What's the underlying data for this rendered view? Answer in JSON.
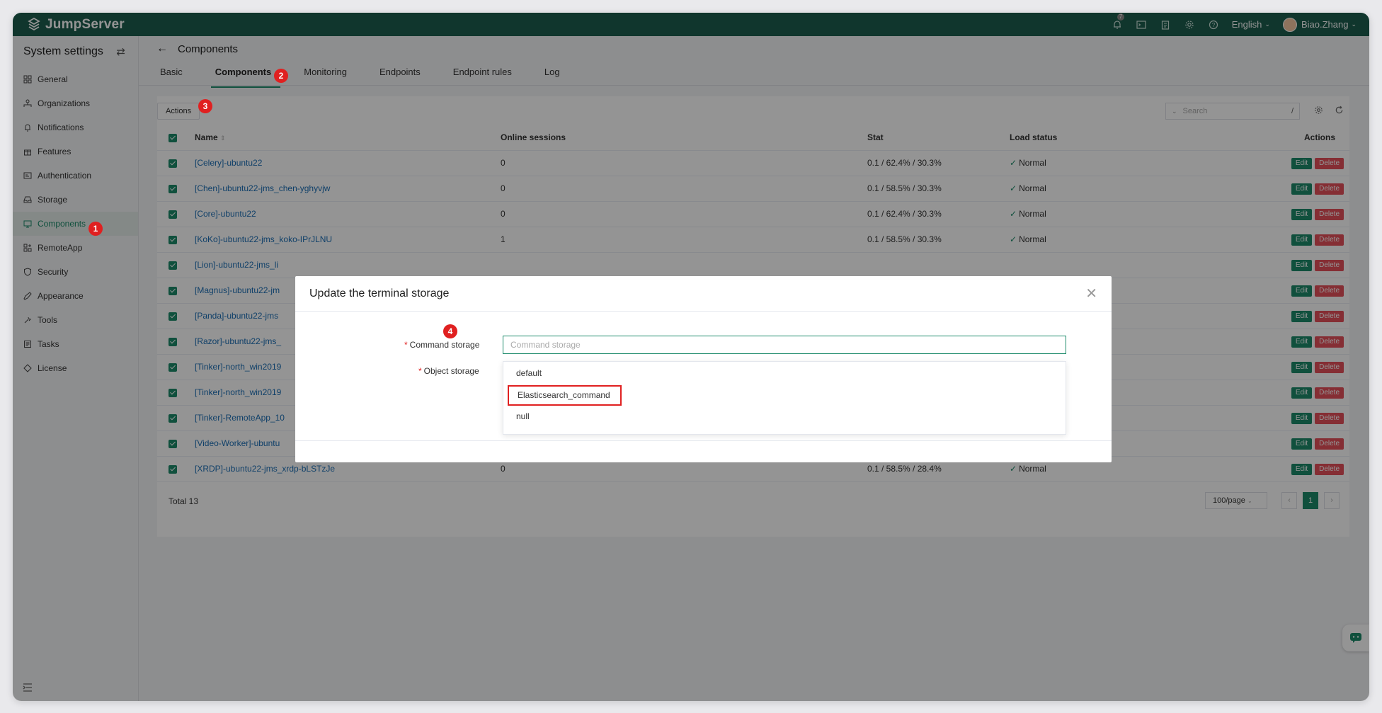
{
  "app": {
    "logo_text": "JumpServer",
    "notification_count": "7",
    "language": "English",
    "user_name": "Biao.Zhang"
  },
  "sidebar": {
    "title": "System settings",
    "items": [
      {
        "label": "General",
        "icon": "grid-icon"
      },
      {
        "label": "Organizations",
        "icon": "org-icon"
      },
      {
        "label": "Notifications",
        "icon": "bell-icon"
      },
      {
        "label": "Features",
        "icon": "gift-icon"
      },
      {
        "label": "Authentication",
        "icon": "id-card-icon"
      },
      {
        "label": "Storage",
        "icon": "inbox-icon"
      },
      {
        "label": "Components",
        "icon": "monitor-icon"
      },
      {
        "label": "RemoteApp",
        "icon": "apps-icon"
      },
      {
        "label": "Security",
        "icon": "shield-icon"
      },
      {
        "label": "Appearance",
        "icon": "brush-icon"
      },
      {
        "label": "Tools",
        "icon": "tools-icon"
      },
      {
        "label": "Tasks",
        "icon": "tasks-icon"
      },
      {
        "label": "License",
        "icon": "license-icon"
      }
    ],
    "active_item": "Components"
  },
  "page": {
    "title": "Components",
    "tabs": [
      "Basic",
      "Components",
      "Monitoring",
      "Endpoints",
      "Endpoint rules",
      "Log"
    ],
    "active_tab": "Components"
  },
  "toolbar": {
    "actions_label": "Actions",
    "search_placeholder": "Search",
    "search_shortcut": "/"
  },
  "table": {
    "columns": [
      "Name",
      "Online sessions",
      "Stat",
      "Load status",
      "Actions"
    ],
    "rows": [
      {
        "name": "[Celery]-ubuntu22",
        "sessions": "0",
        "stat": "0.1 / 62.4% / 30.3%",
        "status": "Normal"
      },
      {
        "name": "[Chen]-ubuntu22-jms_chen-yghyvjw",
        "sessions": "0",
        "stat": "0.1 / 58.5% / 30.3%",
        "status": "Normal"
      },
      {
        "name": "[Core]-ubuntu22",
        "sessions": "0",
        "stat": "0.1 / 62.4% / 30.3%",
        "status": "Normal"
      },
      {
        "name": "[KoKo]-ubuntu22-jms_koko-IPrJLNU",
        "sessions": "1",
        "stat": "0.1 / 58.5% / 30.3%",
        "status": "Normal"
      },
      {
        "name": "[Lion]-ubuntu22-jms_li",
        "sessions": "",
        "stat": "",
        "status": ""
      },
      {
        "name": "[Magnus]-ubuntu22-jm",
        "sessions": "",
        "stat": "",
        "status": ""
      },
      {
        "name": "[Panda]-ubuntu22-jms",
        "sessions": "",
        "stat": "",
        "status": ""
      },
      {
        "name": "[Razor]-ubuntu22-jms_",
        "sessions": "",
        "stat": "",
        "status": ""
      },
      {
        "name": "[Tinker]-north_win2019",
        "sessions": "",
        "stat": "",
        "status": ""
      },
      {
        "name": "[Tinker]-north_win2019",
        "sessions": "",
        "stat": "",
        "status": ""
      },
      {
        "name": "[Tinker]-RemoteApp_10",
        "sessions": "",
        "stat": "",
        "status": ""
      },
      {
        "name": "[Video-Worker]-ubuntu",
        "sessions": "",
        "stat": "",
        "status": ""
      },
      {
        "name": "[XRDP]-ubuntu22-jms_xrdp-bLSTzJe",
        "sessions": "0",
        "stat": "0.1 / 58.5% / 28.4%",
        "status": "Normal"
      }
    ],
    "edit_label": "Edit",
    "delete_label": "Delete",
    "total_label": "Total 13",
    "page_size": "100/page",
    "current_page": "1"
  },
  "modal": {
    "title": "Update the terminal storage",
    "command_storage_label": "Command storage",
    "command_storage_placeholder": "Command storage",
    "object_storage_label": "Object storage",
    "options": [
      "default",
      "Elasticsearch_command",
      "null"
    ],
    "highlighted_option": "Elasticsearch_command"
  },
  "markers": [
    "1",
    "2",
    "3",
    "4"
  ],
  "colors": {
    "brand": "#1c5e4e",
    "accent": "#1c8a6a",
    "danger": "#e6505a",
    "marker": "#e02020"
  }
}
